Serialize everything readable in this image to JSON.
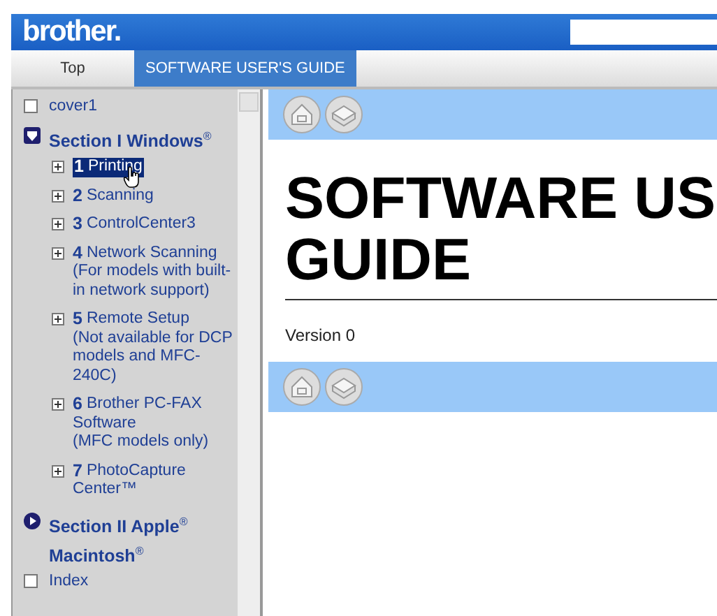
{
  "header": {
    "logo": "brother."
  },
  "tabs": [
    {
      "label": "Top",
      "selected": false
    },
    {
      "label": "SOFTWARE USER'S GUIDE",
      "selected": true
    }
  ],
  "sidebar": {
    "items": [
      {
        "kind": "page",
        "label": "cover1"
      },
      {
        "kind": "section",
        "label": "Section I Windows$^{®}$",
        "expanded": true,
        "children": [
          {
            "number": "1",
            "lines": [
              "Printing"
            ],
            "selected": true
          },
          {
            "number": "2",
            "lines": [
              "Scanning"
            ],
            "selected": false
          },
          {
            "number": "3",
            "lines": [
              "ControlCenter3"
            ],
            "selected": false
          },
          {
            "number": "4",
            "lines": [
              "Network Scanning",
              "(For models with built-",
              "in network support)"
            ],
            "selected": false
          },
          {
            "number": "5",
            "lines": [
              "Remote Setup",
              "(Not available for DCP",
              "models and MFC-",
              "240C)"
            ],
            "selected": false
          },
          {
            "number": "6",
            "lines": [
              "Brother PC-FAX",
              "Software",
              "(MFC models only)"
            ],
            "selected": false
          },
          {
            "number": "7",
            "lines": [
              "PhotoCapture",
              "Center™"
            ],
            "selected": false
          }
        ]
      },
      {
        "kind": "section",
        "label": "Section II Apple$^{®}$ Macintosh$^{®}$",
        "expanded": false
      },
      {
        "kind": "page",
        "label": "Index"
      }
    ]
  },
  "content": {
    "heading_lines": [
      "SOFTWARE US",
      "GUIDE"
    ],
    "version": "Version 0"
  }
}
